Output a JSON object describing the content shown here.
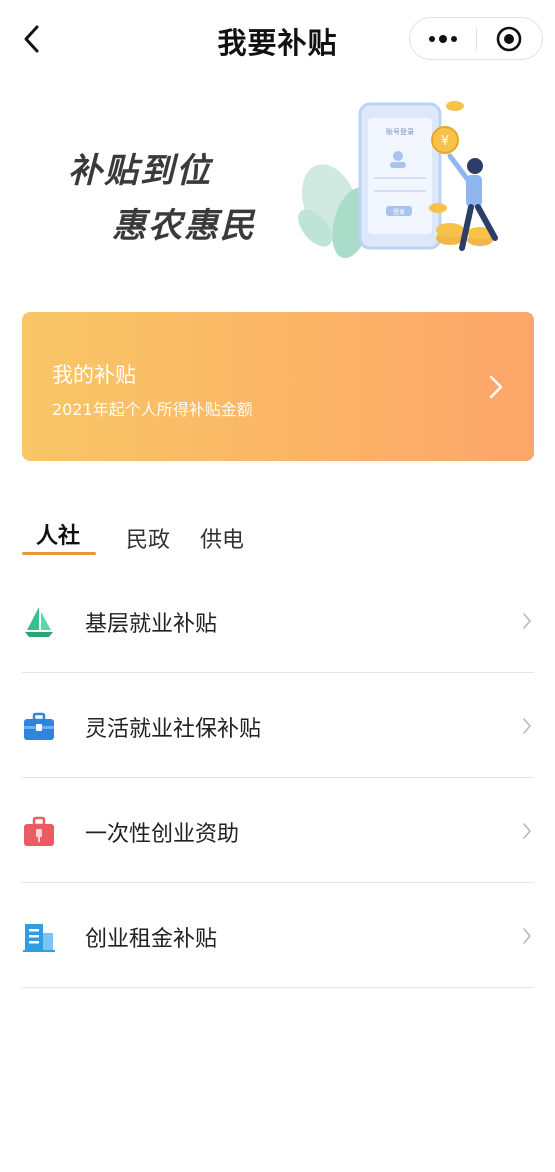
{
  "navbar": {
    "title": "我要补贴",
    "back_icon": "back-chevron-icon",
    "more_icon": "more-dots-icon",
    "close_icon": "target-close-icon"
  },
  "banner": {
    "slogan_line1": "补贴到位",
    "slogan_line2": "惠农惠民",
    "phone_screen_text": "账号登录",
    "phone_button_text": "登录"
  },
  "subsidy_card": {
    "title": "我的补贴",
    "subtitle": "2021年起个人所得补贴金额",
    "gradient_start": "#f8c766",
    "gradient_end": "#fda66a"
  },
  "tabs": [
    {
      "label": "人社",
      "active": true
    },
    {
      "label": "民政",
      "active": false
    },
    {
      "label": "供电",
      "active": false
    }
  ],
  "accent_color": "#e09a3a",
  "items": [
    {
      "label": "基层就业补贴",
      "icon": "sailboat-icon",
      "color": "#36c08e"
    },
    {
      "label": "灵活就业社保补贴",
      "icon": "briefcase-icon",
      "color": "#2f84e0"
    },
    {
      "label": "一次性创业资助",
      "icon": "toolbox-icon",
      "color": "#ec5b64"
    },
    {
      "label": "创业租金补贴",
      "icon": "building-icon",
      "color": "#2f9de0"
    }
  ]
}
